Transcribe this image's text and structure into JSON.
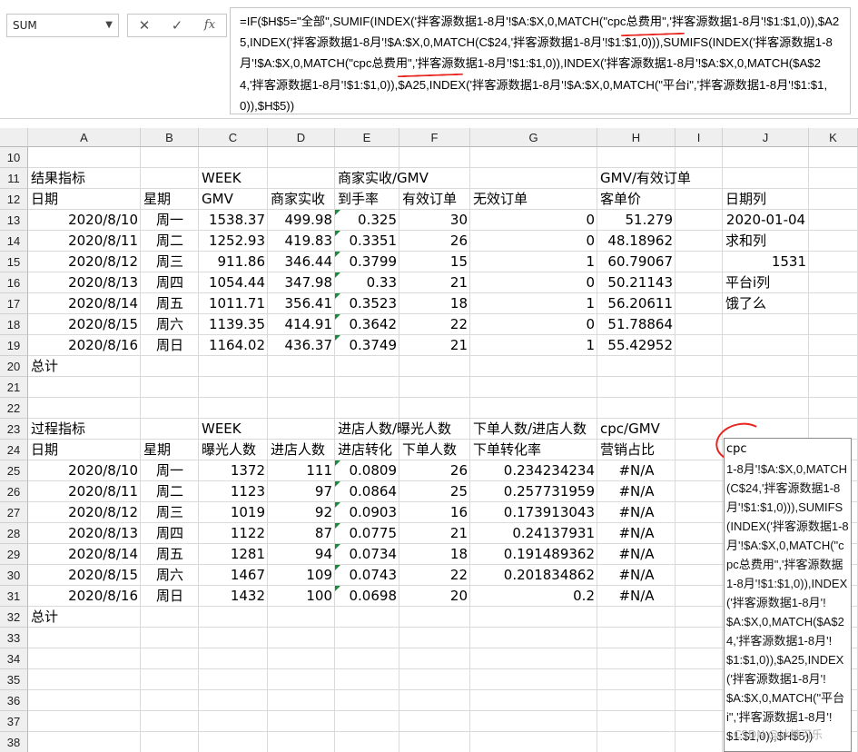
{
  "namebox": {
    "value": "SUM"
  },
  "formula_bar": {
    "cancel_icon": "✕",
    "enter_icon": "✓",
    "fx_label": "fx",
    "formula": "=IF($H$5=\"全部\",SUMIF(INDEX('拌客源数据1-8月'!$A:$X,0,MATCH(\"cpc总费用\",'拌客源数据1-8月'!$1:$1,0)),$A25,INDEX('拌客源数据1-8月'!$A:$X,0,MATCH(C$24,'拌客源数据1-8月'!$1:$1,0))),SUMIFS(INDEX('拌客源数据1-8月'!$A:$X,0,MATCH(\"cpc总费用\",'拌客源数据1-8月'!$1:$1,0)),INDEX('拌客源数据1-8月'!$A:$X,0,MATCH($A$24,'拌客源数据1-8月'!$1:$1,0)),$A25,INDEX('拌客源数据1-8月'!$A:$X,0,MATCH(\"平台i\",'拌客源数据1-8月'!$1:$1,0)),$H$5))"
  },
  "columns": [
    "A",
    "B",
    "C",
    "D",
    "E",
    "F",
    "G",
    "H",
    "I",
    "J",
    "K"
  ],
  "rows": [
    "10",
    "11",
    "12",
    "13",
    "14",
    "15",
    "16",
    "17",
    "18",
    "19",
    "20",
    "21",
    "22",
    "23",
    "24",
    "25",
    "26",
    "27",
    "28",
    "29",
    "30",
    "31",
    "32",
    "33",
    "34",
    "35",
    "36",
    "37",
    "38"
  ],
  "section1": {
    "row11": {
      "a": "结果指标",
      "c": "WEEK",
      "e": "商家实收/GMV",
      "h": "GMV/有效订单"
    },
    "row12": {
      "a": "日期",
      "b": "星期",
      "c": "GMV",
      "d": "商家实收",
      "e": "到手率",
      "f": "有效订单",
      "g": "无效订单",
      "h": "客单价",
      "j": "日期列"
    },
    "data": [
      [
        "2020/8/10",
        "周一",
        "1538.37",
        "499.98",
        "0.325",
        "30",
        "0",
        "51.279"
      ],
      [
        "2020/8/11",
        "周二",
        "1252.93",
        "419.83",
        "0.3351",
        "26",
        "0",
        "48.18962"
      ],
      [
        "2020/8/12",
        "周三",
        "911.86",
        "346.44",
        "0.3799",
        "15",
        "1",
        "60.79067"
      ],
      [
        "2020/8/13",
        "周四",
        "1054.44",
        "347.98",
        "0.33",
        "21",
        "0",
        "50.21143"
      ],
      [
        "2020/8/14",
        "周五",
        "1011.71",
        "356.41",
        "0.3523",
        "18",
        "1",
        "56.20611"
      ],
      [
        "2020/8/15",
        "周六",
        "1139.35",
        "414.91",
        "0.3642",
        "22",
        "0",
        "51.78864"
      ],
      [
        "2020/8/16",
        "周日",
        "1164.02",
        "436.37",
        "0.3749",
        "21",
        "1",
        "55.42952"
      ]
    ],
    "total_label": "总计"
  },
  "side_j": {
    "j13": "2020-01-04",
    "j14": "求和列",
    "j15": "1531",
    "j16": "平台i列",
    "j17": "饿了么"
  },
  "section2": {
    "row23": {
      "a": "过程指标",
      "c": "WEEK",
      "e": "进店人数/曝光人数",
      "g": "下单人数/进店人数",
      "h": "cpc/GMV"
    },
    "row24": {
      "a": "日期",
      "b": "星期",
      "c": "曝光人数",
      "d": "进店人数",
      "e": "进店转化",
      "f": "下单人数",
      "g": "下单转化率",
      "h": "营销占比"
    },
    "data": [
      [
        "2020/8/10",
        "周一",
        "1372",
        "111",
        "0.0809",
        "26",
        "0.234234234",
        "#N/A"
      ],
      [
        "2020/8/11",
        "周二",
        "1123",
        "97",
        "0.0864",
        "25",
        "0.257731959",
        "#N/A"
      ],
      [
        "2020/8/12",
        "周三",
        "1019",
        "92",
        "0.0903",
        "16",
        "0.173913043",
        "#N/A"
      ],
      [
        "2020/8/13",
        "周四",
        "1122",
        "87",
        "0.0775",
        "21",
        "0.24137931",
        "#N/A"
      ],
      [
        "2020/8/14",
        "周五",
        "1281",
        "94",
        "0.0734",
        "18",
        "0.191489362",
        "#N/A"
      ],
      [
        "2020/8/15",
        "周六",
        "1467",
        "109",
        "0.0743",
        "22",
        "0.201834862",
        "#N/A"
      ],
      [
        "2020/8/16",
        "周日",
        "1432",
        "100",
        "0.0698",
        "20",
        "0.2",
        "#N/A"
      ]
    ],
    "total_label": "总计"
  },
  "comment": {
    "head": "cpc",
    "text": "1-8月'!$A:$X,0,MATCH(C$24,'拌客源数据1-8月'!$1:$1,0))),SUMIFS(INDEX('拌客源数据1-8月'!$A:$X,0,MATCH(\"cpc总费用\",'拌客源数据1-8月'!$1:$1,0)),INDEX('拌客源数据1-8月'!$A:$X,0,MATCH($A$24,'拌客源数据1-8月'!$1:$1,0)),$A25,INDEX('拌客源数据1-8月'!$A:$X,0,MATCH(\"平台i\",'拌客源数据1-8月'!$1:$1,0)),$H$5))"
  },
  "watermark": "CSDN @冰糖可乐"
}
